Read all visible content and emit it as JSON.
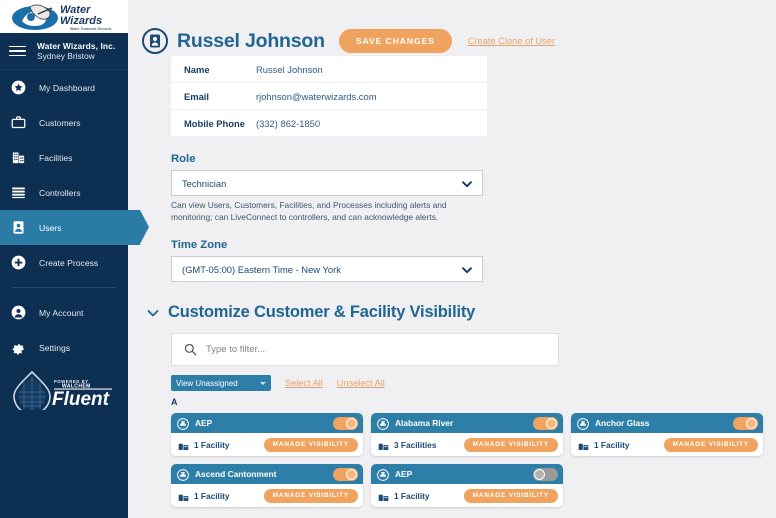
{
  "brand": {
    "logo_name": "water-wizards-logo",
    "logo_line1": "Water",
    "logo_line2": "Wizards",
    "logo_tagline": "Water Treatment Services"
  },
  "sidebar": {
    "org_name": "Water Wizards, Inc.",
    "org_user": "Sydney Bristow",
    "items": [
      {
        "label": "My Dashboard",
        "icon": "star-badge-icon",
        "active": false
      },
      {
        "label": "Customers",
        "icon": "briefcase-icon",
        "active": false
      },
      {
        "label": "Facilities",
        "icon": "building-icon",
        "active": false
      },
      {
        "label": "Controllers",
        "icon": "list-icon",
        "active": false
      },
      {
        "label": "Users",
        "icon": "id-badge-icon",
        "active": true
      },
      {
        "label": "Create Process",
        "icon": "plus-circle-icon",
        "active": false
      }
    ],
    "items_secondary": [
      {
        "label": "My Account",
        "icon": "user-circle-icon",
        "active": false
      },
      {
        "label": "Settings",
        "icon": "gear-icon",
        "active": false
      }
    ],
    "footer_logo": {
      "name": "fluent-logo",
      "powered_by": "POWERED BY",
      "brand": "WALCHEM",
      "wordmark": "Fluent"
    }
  },
  "header": {
    "avatar_icon": "user-badge-icon",
    "title": "Russel Johnson",
    "save_label": "SAVE CHANGES",
    "clone_label": "Create Clone of User"
  },
  "info": {
    "rows": [
      {
        "label": "Name",
        "value": "Russel Johnson"
      },
      {
        "label": "Email",
        "value": "rjohnson@waterwizards.com"
      },
      {
        "label": "Mobile Phone",
        "value": "(332) 862-1850"
      }
    ]
  },
  "role": {
    "label": "Role",
    "value": "Technician",
    "help": "Can view Users, Customers, Facilities, and Processes including alerts and monitoring; can LiveConnect to controllers, and can acknowledge alerts."
  },
  "timezone": {
    "label": "Time Zone",
    "value": "(GMT-05:00) Eastern Time - New York"
  },
  "visibility": {
    "section_title": "Customize Customer & Facility Visibility",
    "filter_placeholder": "Type to filter...",
    "filter_value": "",
    "view_mode": "View Unassigned",
    "select_all": "Select All",
    "unselect_all": "Unselect All",
    "alpha_letter": "A",
    "manage_label": "MANAGE VISIBILITY",
    "cards": [
      {
        "name": "AEP",
        "facilities": "1 Facility",
        "enabled": true
      },
      {
        "name": "Alabama River",
        "facilities": "3 Facilities",
        "enabled": true
      },
      {
        "name": "Anchor Glass",
        "facilities": "1 Facility",
        "enabled": true
      },
      {
        "name": "Ascend Cantonment",
        "facilities": "1 Facility",
        "enabled": true
      },
      {
        "name": "AEP",
        "facilities": "1 Facility",
        "enabled": false
      }
    ]
  },
  "colors": {
    "sidebar_bg": "#0d2f52",
    "accent_blue": "#216591",
    "card_header": "#2e7fa7",
    "accent_orange": "#f0a35e",
    "page_bg": "#f0f0f2"
  }
}
